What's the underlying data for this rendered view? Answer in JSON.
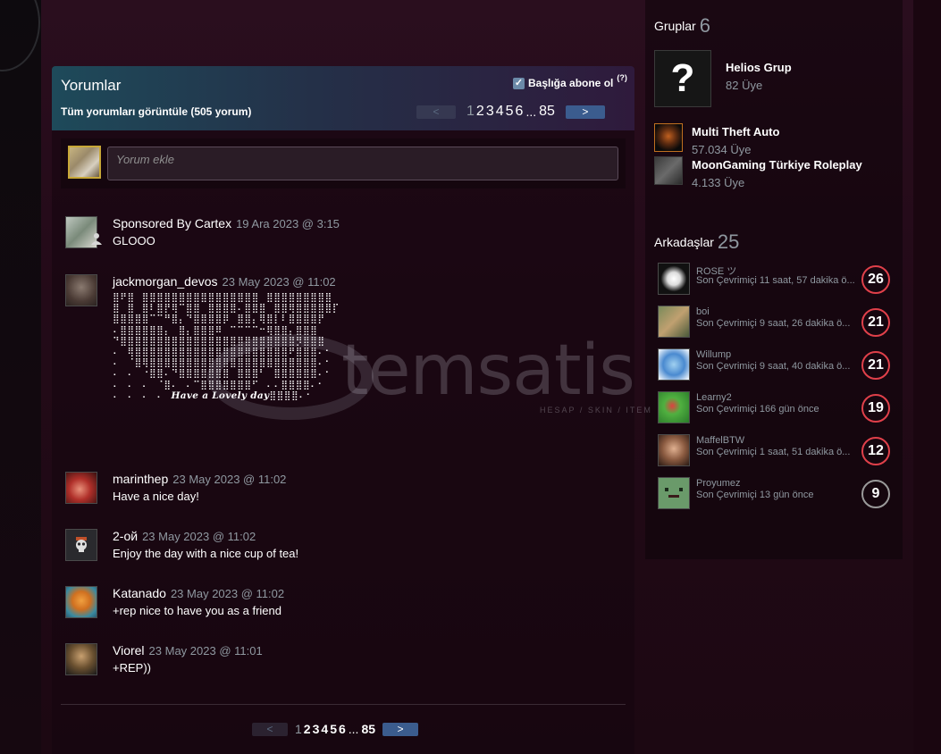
{
  "comments_section": {
    "title": "Yorumlar",
    "view_all": "Tüm yorumları görüntüle (505 yorum)",
    "subscribe_label": "Başlığa abone ol",
    "subscribe_checked": true,
    "help": "(?)",
    "add_placeholder": "Yorum ekle",
    "pager": {
      "prev": "<",
      "next": ">",
      "pages": [
        "1",
        "2",
        "3",
        "4",
        "5",
        "6"
      ],
      "ellipsis": "...",
      "last": "85",
      "current": "1"
    },
    "comments": [
      {
        "author": "Sponsored By Cartex",
        "date": "19 Ara 2023 @ 3:15",
        "text": "GLOOO"
      },
      {
        "author": "jackmorgan_devos",
        "date": "23 May 2023 @ 11:02",
        "text": ""
      },
      {
        "author": "marinthep",
        "date": "23 May 2023 @ 11:02",
        "text": "Have a nice day!"
      },
      {
        "author": "2-ой",
        "date": "23 May 2023 @ 11:02",
        "text": "Enjoy the day with a nice cup of tea!"
      },
      {
        "author": "Katanado",
        "date": "23 May 2023 @ 11:02",
        "text": "+rep nice to have you as a friend"
      },
      {
        "author": "Viorel",
        "date": "23 May 2023 @ 11:01",
        "text": "+REP))"
      }
    ],
    "ascii_art_caption": "Have a Lovely day"
  },
  "groups": {
    "title": "Gruplar",
    "count": "6",
    "items": [
      {
        "name": "Helios Grup",
        "members": "82 Üye",
        "icon": "question-mark-icon"
      },
      {
        "name": "Multi Theft Auto",
        "members": "57.034 Üye",
        "icon": "mta-icon"
      },
      {
        "name": "MoonGaming Türkiye Roleplay",
        "members": "4.133 Üye",
        "icon": "moongaming-icon"
      }
    ]
  },
  "friends": {
    "title": "Arkadaşlar",
    "count": "25",
    "items": [
      {
        "name": "ROSE ツ",
        "status": "Son Çevrimiçi 11 saat, 57 dakika ö...",
        "level": "26",
        "level_color": "#e0404a"
      },
      {
        "name": "boi",
        "status": "Son Çevrimiçi 9 saat, 26 dakika ö...",
        "level": "21",
        "level_color": "#e0404a"
      },
      {
        "name": "Willump",
        "status": "Son Çevrimiçi 9 saat, 40 dakika ö...",
        "level": "21",
        "level_color": "#e0404a"
      },
      {
        "name": "Learny2",
        "status": "Son Çevrimiçi 166 gün önce",
        "level": "19",
        "level_color": "#e0404a"
      },
      {
        "name": "MaffelBTW",
        "status": "Son Çevrimiçi 1 saat, 51 dakika ö...",
        "level": "12",
        "level_color": "#e0404a"
      },
      {
        "name": "Proyumez",
        "status": "Son Çevrimiçi 13 gün önce",
        "level": "9",
        "level_color": "#9a9a9a"
      }
    ]
  },
  "watermark": {
    "text": "temsatis",
    "sub": "HESAP / SKIN / ITEM"
  },
  "colors": {
    "accent_blue": "#3b5c8e",
    "level_red": "#e0404a",
    "level_grey": "#9a9a9a",
    "background": "#2a0e1e"
  }
}
